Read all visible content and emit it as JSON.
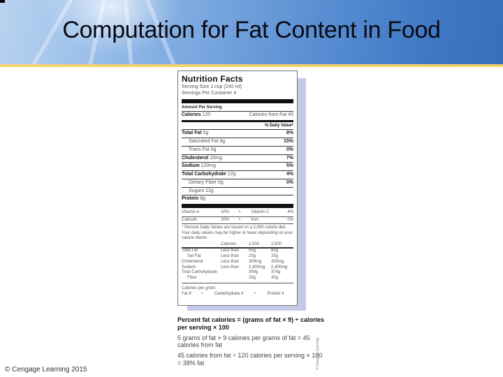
{
  "slide": {
    "title": "Computation for Fat Content in Food",
    "footer": "© Cengage Learning 2015",
    "image_credit": "© Cengage Learning",
    "colors": {
      "banner_start": "#b9d3ef",
      "banner_end": "#3670bd",
      "gold_line": "#f2d36b",
      "label_shadow": "#c3c9e6"
    }
  },
  "label": {
    "title": "Nutrition Facts",
    "serving_size": "Serving Size 1 cup (240 ml)",
    "servings_per_container": "Servings Per Container 4",
    "amount_per_serving": "Amount Per Serving",
    "calories_label": "Calories",
    "calories_value": "120",
    "calories_from_fat": "Calories from Fat 45",
    "daily_value_header": "% Daily Value*",
    "nutrients": [
      {
        "name": "Total Fat",
        "amount": "5g",
        "pct": "8%",
        "bold": true,
        "indent": false
      },
      {
        "name": "Saturated Fat",
        "amount": "3g",
        "pct": "15%",
        "bold": false,
        "indent": true
      },
      {
        "name": "Trans Fat",
        "amount": "0g",
        "pct": "0%",
        "bold": false,
        "indent": true
      },
      {
        "name": "Cholesterol",
        "amount": "20mg",
        "pct": "7%",
        "bold": true,
        "indent": false
      },
      {
        "name": "Sodium",
        "amount": "120mg",
        "pct": "5%",
        "bold": true,
        "indent": false
      },
      {
        "name": "Total Carbohydrate",
        "amount": "12g",
        "pct": "4%",
        "bold": true,
        "indent": false
      },
      {
        "name": "Dietary Fiber",
        "amount": "0g",
        "pct": "0%",
        "bold": false,
        "indent": true
      },
      {
        "name": "Sugars",
        "amount": "12g",
        "pct": "",
        "bold": false,
        "indent": true
      },
      {
        "name": "Protein",
        "amount": "8g",
        "pct": "",
        "bold": true,
        "indent": false
      }
    ],
    "vitamins": [
      {
        "a_name": "Vitamin A",
        "a_pct": "10%",
        "sep": "•",
        "b_name": "Vitamin C",
        "b_pct": "4%"
      },
      {
        "a_name": "Calcium",
        "a_pct": "30%",
        "sep": "•",
        "b_name": "Iron",
        "b_pct": "0%"
      }
    ],
    "footnote": "* Percent Daily Values are based on a 2,000 calorie diet. Your daily values may be higher or lower depending on your calorie needs:",
    "dv_table": {
      "header": [
        "",
        "Calories",
        "2,000",
        "2,500"
      ],
      "rows": [
        [
          "Total Fat",
          "Less than",
          "65g",
          "80g"
        ],
        [
          "  Sat Fat",
          "Less than",
          "20g",
          "25g"
        ],
        [
          "Cholesterol",
          "Less than",
          "300mg",
          "300mg"
        ],
        [
          "Sodium",
          "Less than",
          "2,400mg",
          "2,400mg"
        ],
        [
          "Total Carbohydrate",
          "",
          "300g",
          "375g"
        ],
        [
          "  Fiber",
          "",
          "25g",
          "30g"
        ]
      ]
    },
    "calories_per_gram_label": "Calories per gram:",
    "calories_per_gram": [
      "Fat 9",
      "•",
      "Carbohydrate 4",
      "•",
      "Protein 4"
    ]
  },
  "formula": {
    "definition": "Percent fat calories = (grams of fat × 9) ÷ calories per serving × 100",
    "step1": "5 grams of fat × 9 calories per grams of fat = 45 calories from fat",
    "step2": "45 calories from fat ÷ 120 calories per serving × 100 = 38% fat"
  }
}
